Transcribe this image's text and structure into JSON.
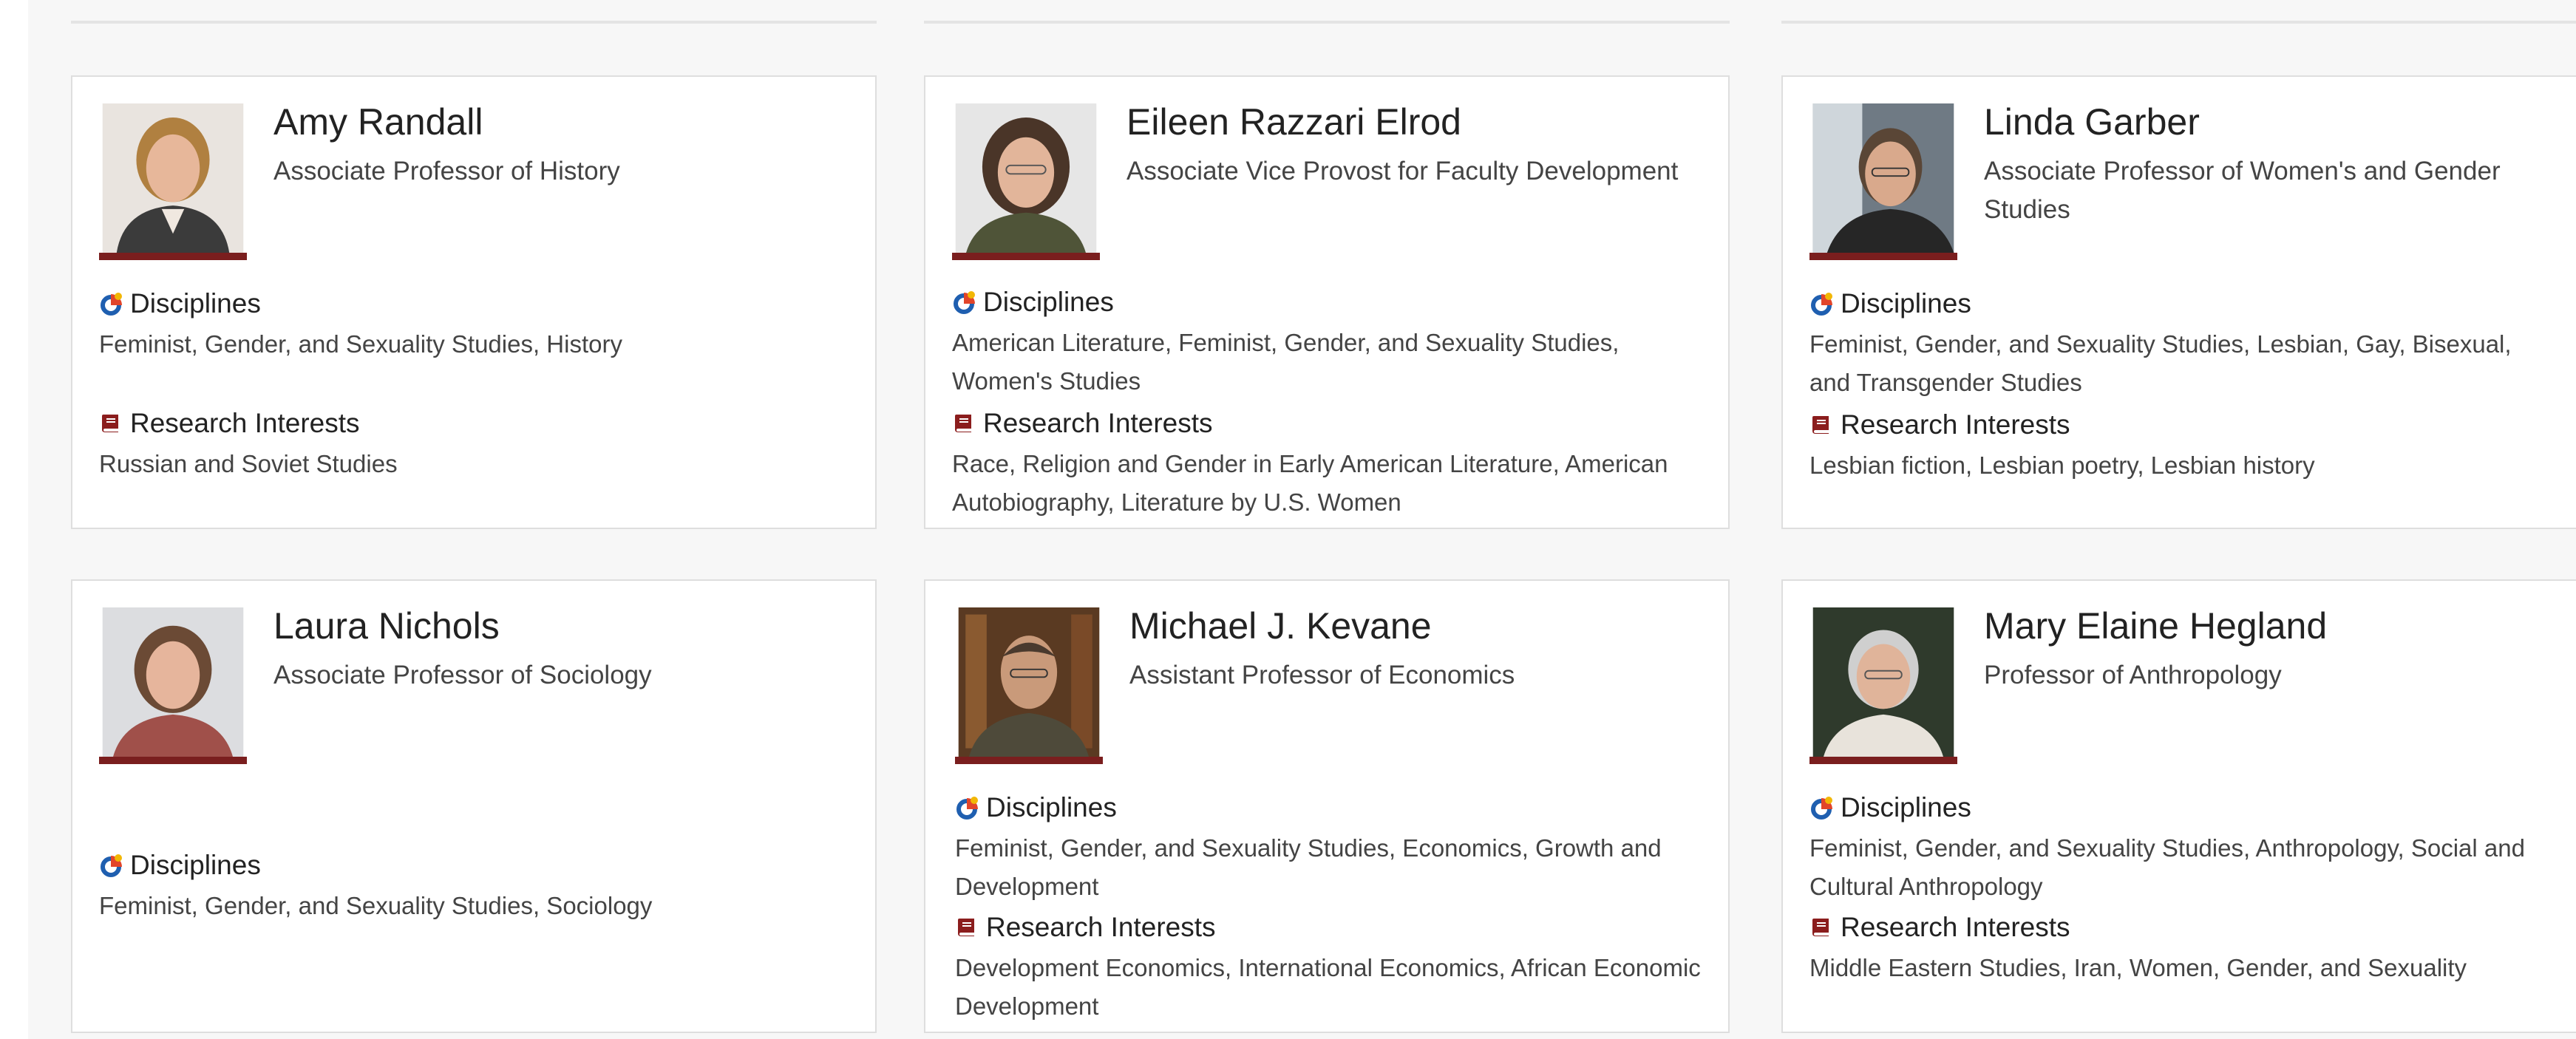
{
  "faculty": [
    {
      "name": "Amy Randall",
      "title": "Associate Professor of History",
      "disciplines_label": "Disciplines",
      "disciplines": "Feminist, Gender, and Sexuality Studies, History",
      "research_label": "Research Interests",
      "research": "Russian and Soviet Studies"
    },
    {
      "name": "Eileen Razzari Elrod",
      "title": "Associate Vice Provost for Faculty Development",
      "disciplines_label": "Disciplines",
      "disciplines": "American Literature, Feminist, Gender, and Sexuality Studies, Women's Studies",
      "research_label": "Research Interests",
      "research": "Race, Religion and Gender in Early American Literature, American Autobiography, Literature by U.S. Women"
    },
    {
      "name": "Linda Garber",
      "title": "Associate Professor of Women's and Gender Studies",
      "disciplines_label": "Disciplines",
      "disciplines": "Feminist, Gender, and Sexuality Studies, Lesbian, Gay, Bisexual, and Transgender Studies",
      "research_label": "Research Interests",
      "research": "Lesbian fiction, Lesbian poetry, Lesbian history"
    },
    {
      "name": "Laura Nichols",
      "title": "Associate Professor of Sociology",
      "disciplines_label": "Disciplines",
      "disciplines": "Feminist, Gender, and Sexuality Studies, Sociology"
    },
    {
      "name": "Michael J. Kevane",
      "title": "Assistant Professor of Economics",
      "disciplines_label": "Disciplines",
      "disciplines": "Feminist, Gender, and Sexuality Studies, Economics, Growth and Development",
      "research_label": "Research Interests",
      "research": "Development Economics, International Economics, African Economic Development"
    },
    {
      "name": "Mary Elaine Hegland",
      "title": "Professor of Anthropology",
      "disciplines_label": "Disciplines",
      "disciplines": "Feminist, Gender, and Sexuality Studies, Anthropology, Social and Cultural Anthropology",
      "research_label": "Research Interests",
      "research": "Middle Eastern Studies, Iran, Women, Gender, and Sexuality"
    }
  ],
  "colors": {
    "accent": "#7a1e1e",
    "book_icon": "#8b1d1d",
    "disciplines_icon_ring": "#1f5fb0",
    "disciplines_icon_wedge": "#e2452a",
    "disciplines_icon_dot": "#f2b705"
  },
  "icons": {
    "disciplines": "disciplines-icon",
    "research": "book-icon"
  }
}
